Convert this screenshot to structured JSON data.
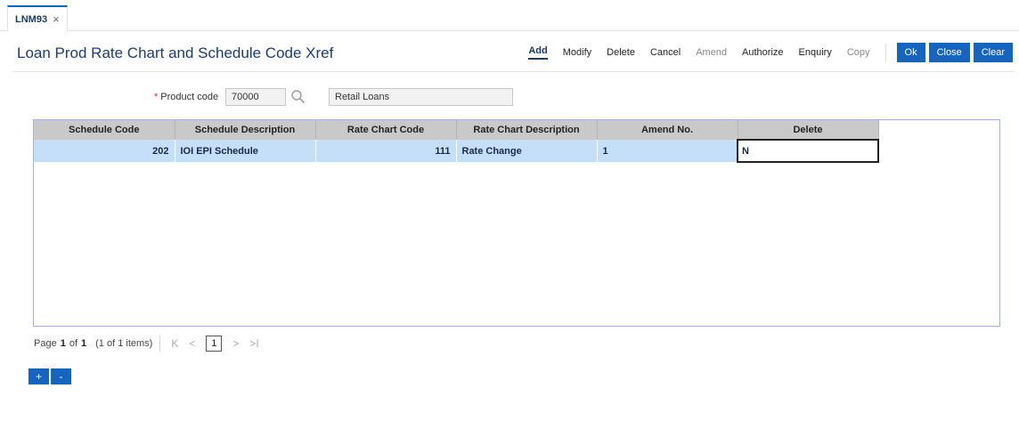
{
  "tab": {
    "label": "LNM93",
    "close": "×"
  },
  "page": {
    "title": "Loan Prod Rate Chart and Schedule Code Xref"
  },
  "toolbar": {
    "add": "Add",
    "modify": "Modify",
    "delete": "Delete",
    "cancel": "Cancel",
    "amend": "Amend",
    "authorize": "Authorize",
    "enquiry": "Enquiry",
    "copy": "Copy",
    "ok": "Ok",
    "close": "Close",
    "clear": "Clear"
  },
  "form": {
    "product_code_label": "Product code",
    "required_mark": "*",
    "product_code_value": "70000",
    "product_desc_value": "Retail Loans"
  },
  "grid": {
    "columns": [
      "Schedule Code",
      "Schedule Description",
      "Rate Chart Code",
      "Rate Chart Description",
      "Amend No.",
      "Delete"
    ],
    "rows": [
      {
        "schedule_code": "202",
        "schedule_description": "IOI EPI Schedule",
        "rate_chart_code": "111",
        "rate_chart_description": "Rate Change",
        "amend_no": "1",
        "delete": "N"
      }
    ]
  },
  "pager": {
    "page_label": "Page",
    "current": "1",
    "of_label": "of",
    "total": "1",
    "items_text": "(1 of 1 items)",
    "first": "K",
    "prev": "<",
    "page_button": "1",
    "next": ">",
    "last": ">I"
  },
  "actions": {
    "add": "+",
    "remove": "-"
  },
  "colors": {
    "accent": "#1565c0",
    "title": "#1e3c72",
    "row_selected": "#c5dff8",
    "header": "#c9c9c9"
  }
}
